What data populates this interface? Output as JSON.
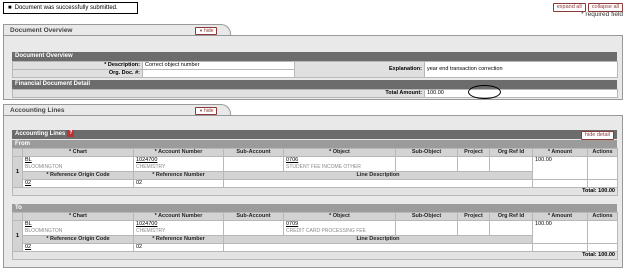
{
  "message": {
    "text": "Document was successfully submitted."
  },
  "top_buttons": {
    "expand_all": "expand all",
    "collapse_all": "collapse all"
  },
  "required_note": "* required field",
  "doc_overview": {
    "tab_label": "Document Overview",
    "hide_label": "hide",
    "header": "Document Overview",
    "description_label": "* Description:",
    "description_value": "Correct object number",
    "org_doc_label": "Org. Doc. #:",
    "org_doc_value": "",
    "explanation_label": "Explanation:",
    "explanation_value": "year end transaction correction",
    "financial_header": "Financial Document Detail",
    "total_amount_label": "Total Amount:",
    "total_amount_value": "100.00"
  },
  "accounting": {
    "tab_label": "Accounting Lines",
    "hide_label": "hide",
    "header": "Accounting Lines",
    "hide_detail": "hide detail",
    "columns": [
      "* Chart",
      "* Account Number",
      "Sub-Account",
      "* Object",
      "Sub-Object",
      "Project",
      "Org Ref Id",
      "* Amount",
      "Actions"
    ],
    "sub_columns": [
      "* Reference Origin Code",
      "* Reference Number",
      "Line Description"
    ],
    "from": {
      "label": "From",
      "row_num": "1",
      "chart": "BL",
      "chart_desc": "BLOOMINGTON",
      "account": "1024700",
      "account_desc": "CHEMISTRY",
      "object": "0706",
      "object_desc": "STUDENT FEE INCOME OTHER",
      "amount": "100.00",
      "ref_origin": "02",
      "ref_number": "02",
      "total": "Total: 100.00"
    },
    "to": {
      "label": "To",
      "row_num": "1",
      "chart": "BL",
      "chart_desc": "BLOOMINGTON",
      "account": "1024700",
      "account_desc": "CHEMISTRY",
      "object": "0709",
      "object_desc": "CREDIT CARD PROCESSING FEE",
      "amount": "100.00",
      "ref_origin": "02",
      "ref_number": "02",
      "total": "Total: 100.00"
    }
  }
}
